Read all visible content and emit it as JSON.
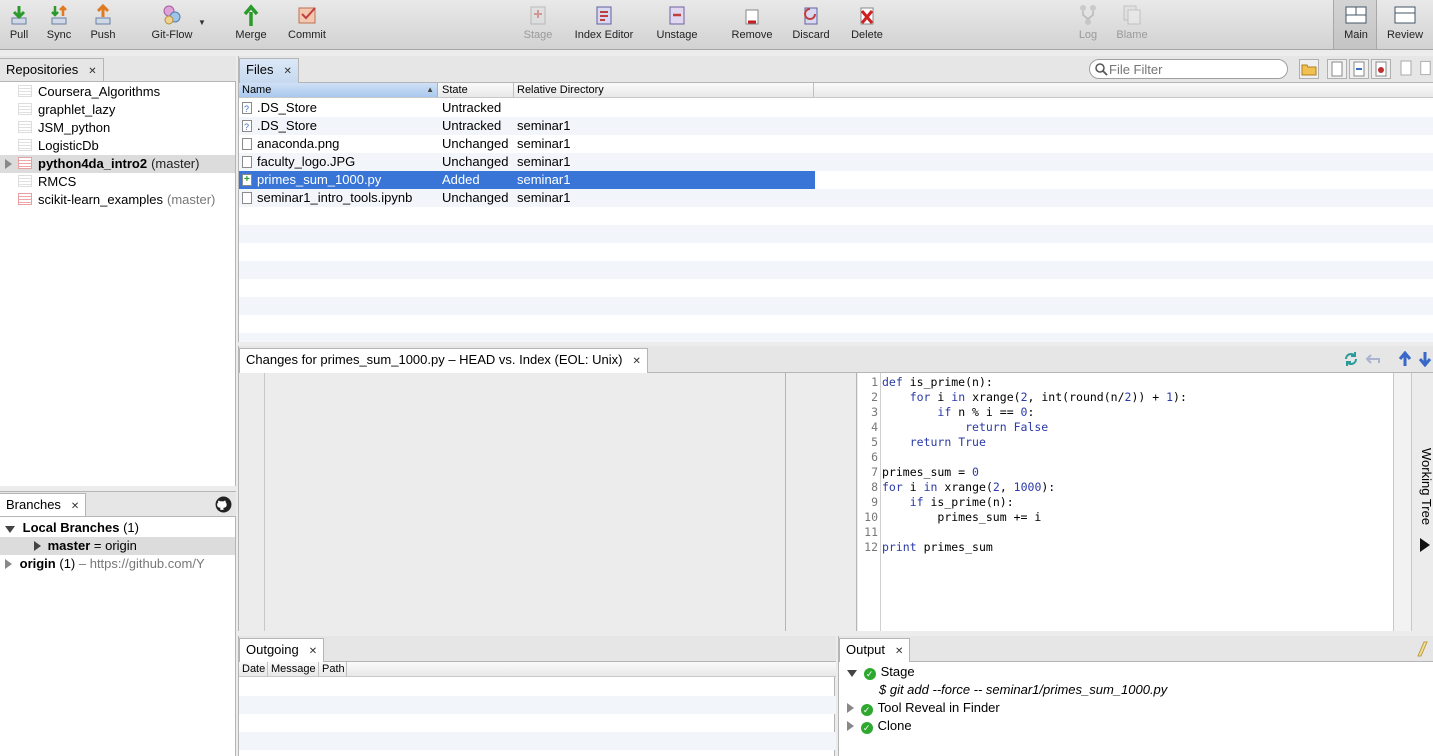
{
  "toolbar": {
    "pull": "Pull",
    "sync": "Sync",
    "push": "Push",
    "gitflow": "Git-Flow",
    "merge": "Merge",
    "commit": "Commit",
    "stage": "Stage",
    "index_editor": "Index Editor",
    "unstage": "Unstage",
    "remove": "Remove",
    "discard": "Discard",
    "delete": "Delete",
    "log": "Log",
    "blame": "Blame",
    "main": "Main",
    "review": "Review"
  },
  "repositories": {
    "tab": "Repositories",
    "items": [
      {
        "name": "Coursera_Algorithms",
        "branch": "",
        "color": "gray"
      },
      {
        "name": "graphlet_lazy",
        "branch": "",
        "color": "gray"
      },
      {
        "name": "JSM_python",
        "branch": "",
        "color": "gray"
      },
      {
        "name": "LogisticDb",
        "branch": "",
        "color": "gray"
      },
      {
        "name": "python4da_intro2",
        "branch": "(master)",
        "color": "red"
      },
      {
        "name": "RMCS",
        "branch": "",
        "color": "gray"
      },
      {
        "name": "scikit-learn_examples",
        "branch": "(master)",
        "color": "red"
      }
    ]
  },
  "branches": {
    "tab": "Branches",
    "local_label": "Local Branches",
    "local_count": "(1)",
    "master": "master",
    "master_tracking": "= origin",
    "origin": "origin",
    "origin_count": "(1)",
    "origin_url": "– https://github.com/Y"
  },
  "files": {
    "tab": "Files",
    "filter_placeholder": "File Filter",
    "columns": {
      "name": "Name",
      "state": "State",
      "dir": "Relative Directory"
    },
    "rows": [
      {
        "name": ".DS_Store",
        "state": "Untracked",
        "dir": "",
        "icon": "question"
      },
      {
        "name": ".DS_Store",
        "state": "Untracked",
        "dir": "seminar1",
        "icon": "question"
      },
      {
        "name": "anaconda.png",
        "state": "Unchanged",
        "dir": "seminar1",
        "icon": "plain"
      },
      {
        "name": "faculty_logo.JPG",
        "state": "Unchanged",
        "dir": "seminar1",
        "icon": "plain"
      },
      {
        "name": "primes_sum_1000.py",
        "state": "Added",
        "dir": "seminar1",
        "icon": "added"
      },
      {
        "name": "seminar1_intro_tools.ipynb",
        "state": "Unchanged",
        "dir": "seminar1",
        "icon": "plain"
      }
    ]
  },
  "changes": {
    "tab": "Changes for primes_sum_1000.py – HEAD vs. Index (EOL: Unix)",
    "working_tree": "Working Tree",
    "code": [
      "def is_prime(n):",
      "    for i in xrange(2, int(round(n/2)) + 1):",
      "        if n % i == 0:",
      "            return False",
      "    return True",
      "",
      "primes_sum = 0",
      "for i in xrange(2, 1000):",
      "    if is_prime(n):",
      "        primes_sum += i",
      "",
      "print primes_sum"
    ]
  },
  "outgoing": {
    "tab": "Outgoing",
    "columns": {
      "date": "Date",
      "message": "Message",
      "path": "Path"
    }
  },
  "output": {
    "tab": "Output",
    "stage": "Stage",
    "stage_cmd": "$ git add --force -- seminar1/primes_sum_1000.py",
    "reveal": "Tool Reveal in Finder",
    "clone": "Clone"
  },
  "colors": {
    "selection": "#3875d7",
    "stripe": "#f2f5fa",
    "success": "#2fa82f"
  }
}
